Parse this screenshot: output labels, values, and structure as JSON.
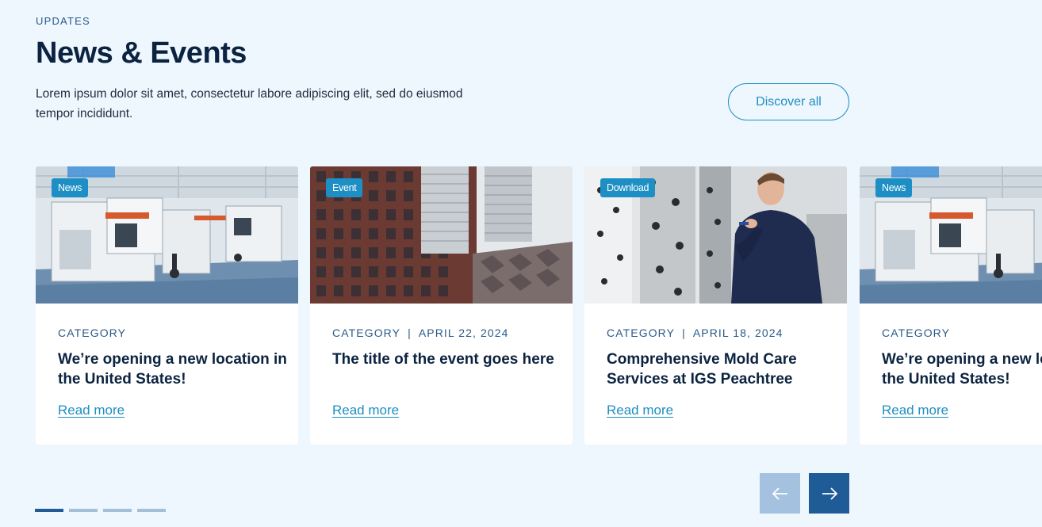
{
  "header": {
    "eyebrow": "UPDATES",
    "title": "News & Events",
    "intro": "Lorem ipsum dolor sit amet, consectetur labore adipiscing elit, sed do eiusmod tempor incididunt.",
    "discover_label": "Discover all"
  },
  "cards": [
    {
      "badge": "News",
      "category": "CATEGORY",
      "date": "",
      "title": "We’re opening a new location in the United States!",
      "link": "Read more",
      "image": "factory-machines"
    },
    {
      "badge": "Event",
      "category": "CATEGORY",
      "date": "APRIL 22, 2024",
      "title": "The title of the event goes here",
      "link": "Read more",
      "image": "office-buildings"
    },
    {
      "badge": "Download",
      "category": "CATEGORY",
      "date": "APRIL 18, 2024",
      "title": "Comprehensive Mold Care Services at IGS Peachtree",
      "link": "Read more",
      "image": "technician-mold"
    },
    {
      "badge": "News",
      "category": "CATEGORY",
      "date": "",
      "title": "We’re opening a new location in the United States!",
      "link": "Read more",
      "image": "factory-machines"
    }
  ],
  "pagination": {
    "count": 4,
    "active_index": 0
  },
  "navigation": {
    "prev_icon": "arrow-left-icon",
    "next_icon": "arrow-right-icon"
  },
  "colors": {
    "background": "#eef6fe",
    "accent": "#1d8fc4",
    "primary_dark": "#1f5c97",
    "heading": "#0b2340"
  }
}
